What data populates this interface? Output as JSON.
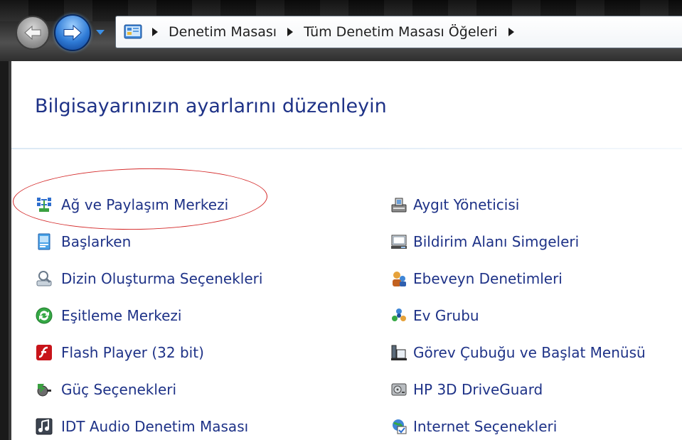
{
  "breadcrumb": {
    "items": [
      "Denetim Masası",
      "Tüm Denetim Masası Öğeleri"
    ]
  },
  "page": {
    "title": "Bilgisayarınızın ayarlarını düzenleyin"
  },
  "items_left": [
    {
      "label": "Ağ ve Paylaşım Merkezi",
      "icon": "network-sharing-icon"
    },
    {
      "label": "Başlarken",
      "icon": "getting-started-icon"
    },
    {
      "label": "Dizin Oluşturma Seçenekleri",
      "icon": "indexing-options-icon"
    },
    {
      "label": "Eşitleme Merkezi",
      "icon": "sync-center-icon"
    },
    {
      "label": "Flash Player (32 bit)",
      "icon": "flash-player-icon"
    },
    {
      "label": "Güç Seçenekleri",
      "icon": "power-options-icon"
    },
    {
      "label": "IDT Audio Denetim Masası",
      "icon": "idt-audio-icon"
    }
  ],
  "items_right": [
    {
      "label": "Aygıt Yöneticisi",
      "icon": "device-manager-icon"
    },
    {
      "label": "Bildirim Alanı Simgeleri",
      "icon": "notification-icons-icon"
    },
    {
      "label": "Ebeveyn Denetimleri",
      "icon": "parental-controls-icon"
    },
    {
      "label": "Ev Grubu",
      "icon": "homegroup-icon"
    },
    {
      "label": "Görev Çubuğu ve Başlat Menüsü",
      "icon": "taskbar-start-menu-icon"
    },
    {
      "label": "HP 3D DriveGuard",
      "icon": "hp-driveguard-icon"
    },
    {
      "label": "Internet Seçenekleri",
      "icon": "internet-options-icon"
    }
  ],
  "colors": {
    "link": "#1e3287",
    "highlight": "#d42a2a"
  }
}
